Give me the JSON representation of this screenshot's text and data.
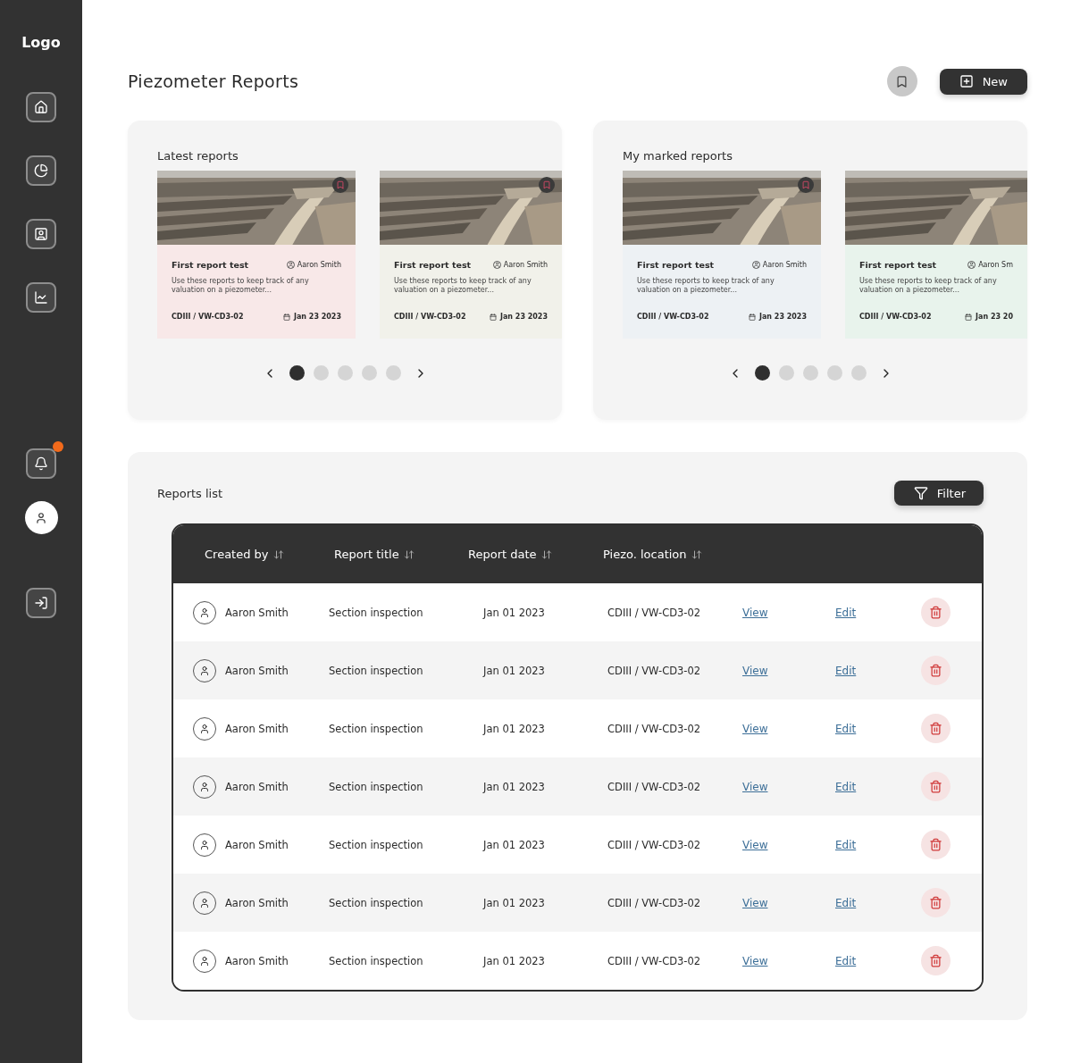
{
  "sidebar": {
    "logo": "Logo",
    "nav": [
      {
        "kind": "home",
        "selected": false
      },
      {
        "kind": "chart",
        "selected": false
      },
      {
        "kind": "contact",
        "selected": false
      },
      {
        "kind": "trend",
        "selected": false
      }
    ],
    "notifications": {
      "unread": true
    },
    "logout": {
      "kind": "logout"
    }
  },
  "header": {
    "title": "Piezometer Reports",
    "new_button": "New"
  },
  "carousels": [
    {
      "title": "Latest reports",
      "cards": [
        {
          "title": "First report test",
          "author": "Aaron Smith",
          "description": "Use these reports to keep track of any valuation on a piezometer...",
          "location": "CDIII / VW-CD3-02",
          "date": "Jan 23 2023",
          "color": "#f8e8e8",
          "bookmarked": true
        },
        {
          "title": "First report test",
          "author": "Aaron Smith",
          "description": "Use these reports to keep track of any valuation on a piezometer...",
          "location": "CDIII / VW-CD3-02",
          "date": "Jan 23 2023",
          "color": "#f1f1ea",
          "bookmarked": true
        }
      ],
      "pages": [
        {
          "selected": true
        },
        {
          "selected": false
        },
        {
          "selected": false
        },
        {
          "selected": false
        },
        {
          "selected": false
        }
      ]
    },
    {
      "title": "My marked reports",
      "cards": [
        {
          "title": "First report test",
          "author": "Aaron Smith",
          "description": "Use these reports to keep track of any valuation on a piezometer...",
          "location": "CDIII / VW-CD3-02",
          "date": "Jan 23 2023",
          "color": "#edf1f4",
          "bookmarked": true
        },
        {
          "title": "First report test",
          "author": "Aaron Sm",
          "description": "Use these reports to keep track of any valuation on a piezometer...",
          "location": "CDIII / VW-CD3-02",
          "date": "Jan 23 20",
          "color": "#e8f3ec",
          "bookmarked": false
        }
      ],
      "pages": [
        {
          "selected": true
        },
        {
          "selected": false
        },
        {
          "selected": false
        },
        {
          "selected": false
        },
        {
          "selected": false
        }
      ]
    }
  ],
  "reports_list": {
    "title": "Reports list",
    "filter_button": "Filter",
    "columns": [
      "Created by",
      "Report title",
      "Report date",
      "Piezo. location"
    ],
    "rows": [
      {
        "created_by": "Aaron Smith",
        "title": "Section inspection",
        "date": "Jan 01 2023",
        "location": "CDIII / VW-CD3-02",
        "view": "View",
        "edit": "Edit"
      },
      {
        "created_by": "Aaron Smith",
        "title": "Section inspection",
        "date": "Jan 01 2023",
        "location": "CDIII / VW-CD3-02",
        "view": "View",
        "edit": "Edit"
      },
      {
        "created_by": "Aaron Smith",
        "title": "Section inspection",
        "date": "Jan 01 2023",
        "location": "CDIII / VW-CD3-02",
        "view": "View",
        "edit": "Edit"
      },
      {
        "created_by": "Aaron Smith",
        "title": "Section inspection",
        "date": "Jan 01 2023",
        "location": "CDIII / VW-CD3-02",
        "view": "View",
        "edit": "Edit"
      },
      {
        "created_by": "Aaron Smith",
        "title": "Section inspection",
        "date": "Jan 01 2023",
        "location": "CDIII / VW-CD3-02",
        "view": "View",
        "edit": "Edit"
      },
      {
        "created_by": "Aaron Smith",
        "title": "Section inspection",
        "date": "Jan 01 2023",
        "location": "CDIII / VW-CD3-02",
        "view": "View",
        "edit": "Edit"
      },
      {
        "created_by": "Aaron Smith",
        "title": "Section inspection",
        "date": "Jan 01 2023",
        "location": "CDIII / VW-CD3-02",
        "view": "View",
        "edit": "Edit"
      }
    ]
  }
}
